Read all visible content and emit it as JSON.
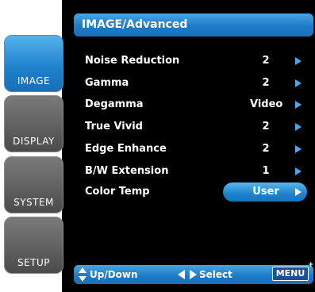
{
  "window": {
    "title": "IMAGE/Advanced"
  },
  "tabs": [
    {
      "label": "IMAGE",
      "active": true
    },
    {
      "label": "DISPLAY",
      "active": false
    },
    {
      "label": "SYSTEM",
      "active": false
    },
    {
      "label": "SETUP",
      "active": false
    }
  ],
  "settings": [
    {
      "label": "Noise Reduction",
      "value": "2"
    },
    {
      "label": "Gamma",
      "value": "2"
    },
    {
      "label": "Degamma",
      "value": "Video"
    },
    {
      "label": "True Vivid",
      "value": "2"
    },
    {
      "label": "Edge Enhance",
      "value": "2"
    },
    {
      "label": "B/W Extension",
      "value": "1"
    },
    {
      "label": "Color Temp",
      "value": "User",
      "selected": true
    }
  ],
  "footer": {
    "updown_label": "Up/Down",
    "select_label": "Select",
    "menu_label": "MENU"
  },
  "icons": {
    "row_arrow": "right-triangle-icon",
    "updown": "up-down-arrows-icon",
    "leftright": "left-right-arrows-icon"
  },
  "colors": {
    "accent": "#1d7cc8",
    "highlight": "#4aa7e6",
    "panel": "#000000",
    "tab_inactive": "#5f5f5f"
  }
}
